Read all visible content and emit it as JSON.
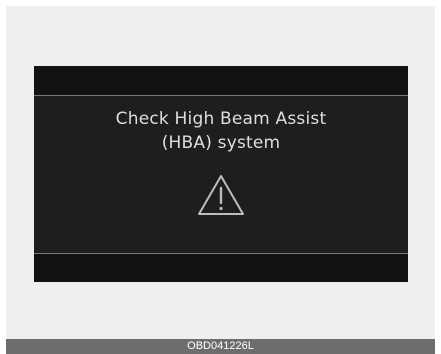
{
  "display": {
    "message_line1": "Check High Beam Assist",
    "message_line2": "(HBA) system",
    "icon": "warning-triangle-icon"
  },
  "footer": {
    "code": "OBD041226L"
  },
  "colors": {
    "display_background": "#1e1e1e",
    "band_background": "#121212",
    "text": "#dedede",
    "separator": "#7a7a7a",
    "footer_background": "#6d6d6d"
  }
}
